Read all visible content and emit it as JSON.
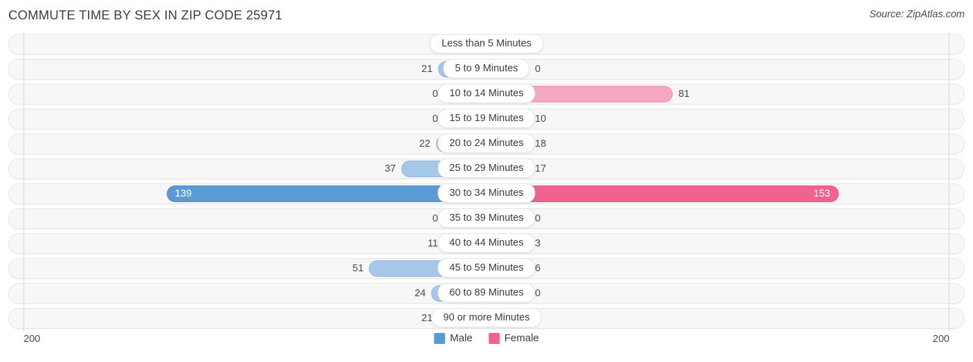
{
  "header": {
    "title": "COMMUTE TIME BY SEX IN ZIP CODE 25971",
    "source": "Source: ZipAtlas.com"
  },
  "legend": {
    "male_label": "Male",
    "female_label": "Female",
    "male_color": "#5b9bd5",
    "female_color": "#f0638f"
  },
  "axis": {
    "left_end": "200",
    "right_end": "200",
    "max": 200
  },
  "chart_data": {
    "type": "bar",
    "subtype": "diverging-butterfly",
    "title": "COMMUTE TIME BY SEX IN ZIP CODE 25971",
    "xlabel": "",
    "ylabel": "",
    "xlim": [
      200,
      200
    ],
    "grid": false,
    "legend_position": "bottom-center",
    "categories": [
      "Less than 5 Minutes",
      "5 to 9 Minutes",
      "10 to 14 Minutes",
      "15 to 19 Minutes",
      "20 to 24 Minutes",
      "25 to 29 Minutes",
      "30 to 34 Minutes",
      "35 to 39 Minutes",
      "40 to 44 Minutes",
      "45 to 59 Minutes",
      "60 to 89 Minutes",
      "90 or more Minutes"
    ],
    "series": [
      {
        "name": "Male",
        "color": "#5b9bd5",
        "values": [
          0,
          21,
          0,
          0,
          22,
          37,
          139,
          0,
          11,
          51,
          24,
          21
        ]
      },
      {
        "name": "Female",
        "color": "#f0638f",
        "values": [
          0,
          0,
          81,
          10,
          18,
          17,
          153,
          0,
          3,
          6,
          0,
          0
        ]
      }
    ],
    "highlighted_category": "30 to 34 Minutes"
  },
  "rows": [
    {
      "label": "Less than 5 Minutes",
      "male": "0",
      "female": "0",
      "male_value": 0,
      "female_value": 0,
      "highlight": false
    },
    {
      "label": "5 to 9 Minutes",
      "male": "21",
      "female": "0",
      "male_value": 21,
      "female_value": 0,
      "highlight": false
    },
    {
      "label": "10 to 14 Minutes",
      "male": "0",
      "female": "81",
      "male_value": 0,
      "female_value": 81,
      "highlight": false
    },
    {
      "label": "15 to 19 Minutes",
      "male": "0",
      "female": "10",
      "male_value": 0,
      "female_value": 10,
      "highlight": false
    },
    {
      "label": "20 to 24 Minutes",
      "male": "22",
      "female": "18",
      "male_value": 22,
      "female_value": 18,
      "highlight": false
    },
    {
      "label": "25 to 29 Minutes",
      "male": "37",
      "female": "17",
      "male_value": 37,
      "female_value": 17,
      "highlight": false
    },
    {
      "label": "30 to 34 Minutes",
      "male": "139",
      "female": "153",
      "male_value": 139,
      "female_value": 153,
      "highlight": true
    },
    {
      "label": "35 to 39 Minutes",
      "male": "0",
      "female": "0",
      "male_value": 0,
      "female_value": 0,
      "highlight": false
    },
    {
      "label": "40 to 44 Minutes",
      "male": "11",
      "female": "3",
      "male_value": 11,
      "female_value": 3,
      "highlight": false
    },
    {
      "label": "45 to 59 Minutes",
      "male": "51",
      "female": "6",
      "male_value": 51,
      "female_value": 6,
      "highlight": false
    },
    {
      "label": "60 to 89 Minutes",
      "male": "24",
      "female": "0",
      "male_value": 24,
      "female_value": 0,
      "highlight": false
    },
    {
      "label": "90 or more Minutes",
      "male": "21",
      "female": "0",
      "male_value": 21,
      "female_value": 0,
      "highlight": false
    }
  ]
}
